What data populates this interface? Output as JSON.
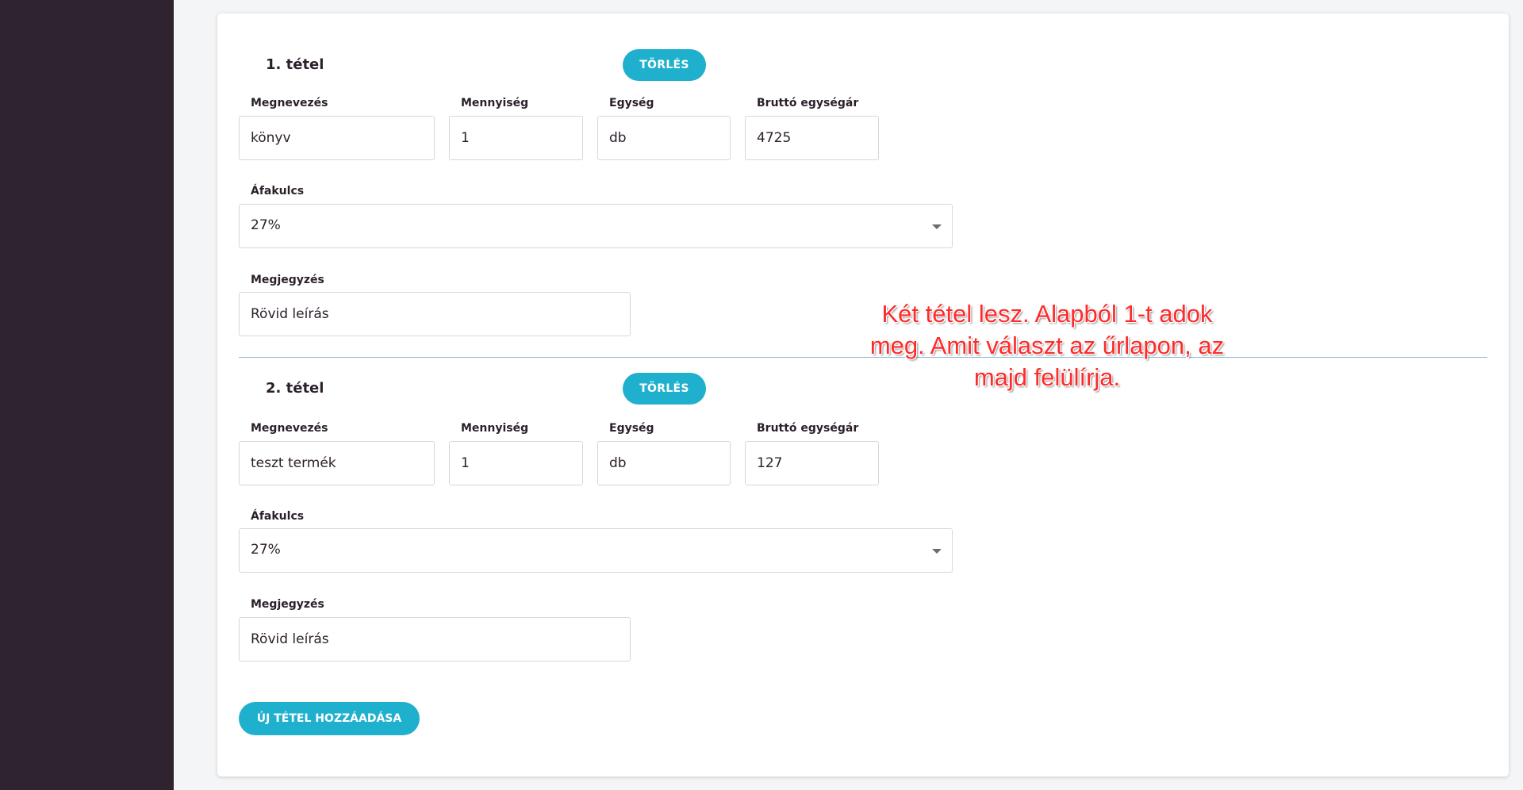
{
  "items": [
    {
      "title": "1. tétel",
      "delete_label": "TÖRLÉS",
      "name_label": "Megnevezés",
      "name_value": "könyv",
      "qty_label": "Mennyiség",
      "qty_value": "1",
      "unit_label": "Egység",
      "unit_value": "db",
      "price_label": "Bruttó egységár",
      "price_value": "4725",
      "vat_label": "Áfakulcs",
      "vat_value": "27%",
      "note_label": "Megjegyzés",
      "note_value": "Rövid leírás"
    },
    {
      "title": "2. tétel",
      "delete_label": "TÖRLÉS",
      "name_label": "Megnevezés",
      "name_value": "teszt termék",
      "qty_label": "Mennyiség",
      "qty_value": "1",
      "unit_label": "Egység",
      "unit_value": "db",
      "price_label": "Bruttó egységár",
      "price_value": "127",
      "vat_label": "Áfakulcs",
      "vat_value": "27%",
      "note_label": "Megjegyzés",
      "note_value": "Rövid leírás"
    }
  ],
  "add_item_label": "ÚJ TÉTEL HOZZÁADÁSA",
  "annotation_text": "Két tétel lesz. Alapból 1-t adok meg. Amit választ az űrlapon, az majd felülírja.",
  "colors": {
    "accent": "#1fb0cd",
    "sidebar": "#2f232f",
    "annotation": "#ff2a2a"
  }
}
